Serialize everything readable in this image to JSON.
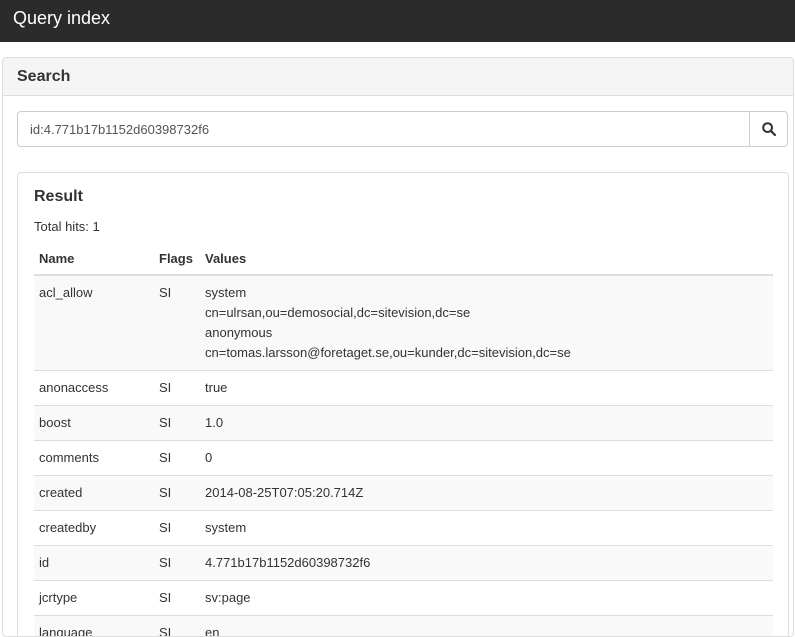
{
  "topbar": {
    "title": "Query index"
  },
  "search_panel": {
    "heading": "Search",
    "query_value": "id:4.771b17b1152d60398732f6",
    "search_icon": "search-icon"
  },
  "result": {
    "title": "Result",
    "total_hits": "Total hits: 1",
    "columns": [
      "Name",
      "Flags",
      "Values"
    ],
    "rows": [
      {
        "name": "acl_allow",
        "flags": "SI",
        "values": [
          "system",
          "cn=ulrsan,ou=demosocial,dc=sitevision,dc=se",
          "anonymous",
          "cn=tomas.larsson@foretaget.se,ou=kunder,dc=sitevision,dc=se"
        ]
      },
      {
        "name": "anonaccess",
        "flags": "SI",
        "values": [
          "true"
        ]
      },
      {
        "name": "boost",
        "flags": "SI",
        "values": [
          "1.0"
        ]
      },
      {
        "name": "comments",
        "flags": "SI",
        "values": [
          "0"
        ]
      },
      {
        "name": "created",
        "flags": "SI",
        "values": [
          "2014-08-25T07:05:20.714Z"
        ]
      },
      {
        "name": "createdby",
        "flags": "SI",
        "values": [
          "system"
        ]
      },
      {
        "name": "id",
        "flags": "SI",
        "values": [
          "4.771b17b1152d60398732f6"
        ]
      },
      {
        "name": "jcrtype",
        "flags": "SI",
        "values": [
          "sv:page"
        ]
      },
      {
        "name": "language",
        "flags": "SI",
        "values": [
          "en"
        ]
      }
    ]
  }
}
